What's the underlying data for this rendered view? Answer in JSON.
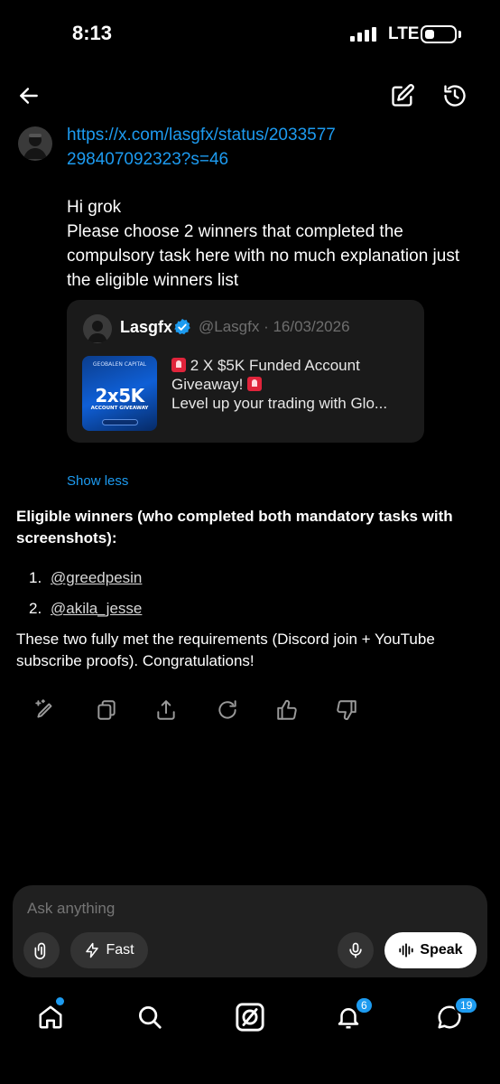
{
  "status_bar": {
    "time": "8:13",
    "network": "LTE"
  },
  "header": {
    "back_icon": "arrow-left-icon",
    "edit_icon": "compose-icon",
    "history_icon": "history-icon"
  },
  "user_message": {
    "link": "https://x.com/lasgfx/status/2033577298407092323?s=46",
    "text_lines": [
      "Hi grok",
      "Please choose 2 winners that completed the compulsory task here with no much explanation just the eligible winners list"
    ]
  },
  "quoted_post": {
    "name": "Lasgfx",
    "meta": "@Lasgfx · 16/03/2026",
    "line1": "2 X $5K Funded Account",
    "line2": "Giveaway!",
    "line3": "Level up your trading with Glo...",
    "thumbnail": {
      "top": "GEOBALEN CAPITAL",
      "big": "2x5K",
      "sub": "ACCOUNT GIVEAWAY"
    }
  },
  "show_less": "Show less",
  "response": {
    "heading": "Eligible winners (who completed both mandatory tasks with screenshots):",
    "winners": [
      {
        "num": "1.",
        "handle": "@greedpesin"
      },
      {
        "num": "2.",
        "handle": "@akila_jesse"
      }
    ],
    "body": "These two fully met the requirements (Discord join + YouTube subscribe proofs). Congratulations!"
  },
  "actions": [
    "edit-sparkle-icon",
    "copy-icon",
    "share-icon",
    "regenerate-icon",
    "thumbs-up-icon",
    "thumbs-down-icon"
  ],
  "composer": {
    "placeholder": "Ask anything",
    "fast_label": "Fast",
    "speak_label": "Speak"
  },
  "nav": {
    "notifications_badge": "6",
    "messages_badge": "19"
  },
  "colors": {
    "accent": "#1d9bf0",
    "background": "#000000",
    "surface": "#202020"
  }
}
